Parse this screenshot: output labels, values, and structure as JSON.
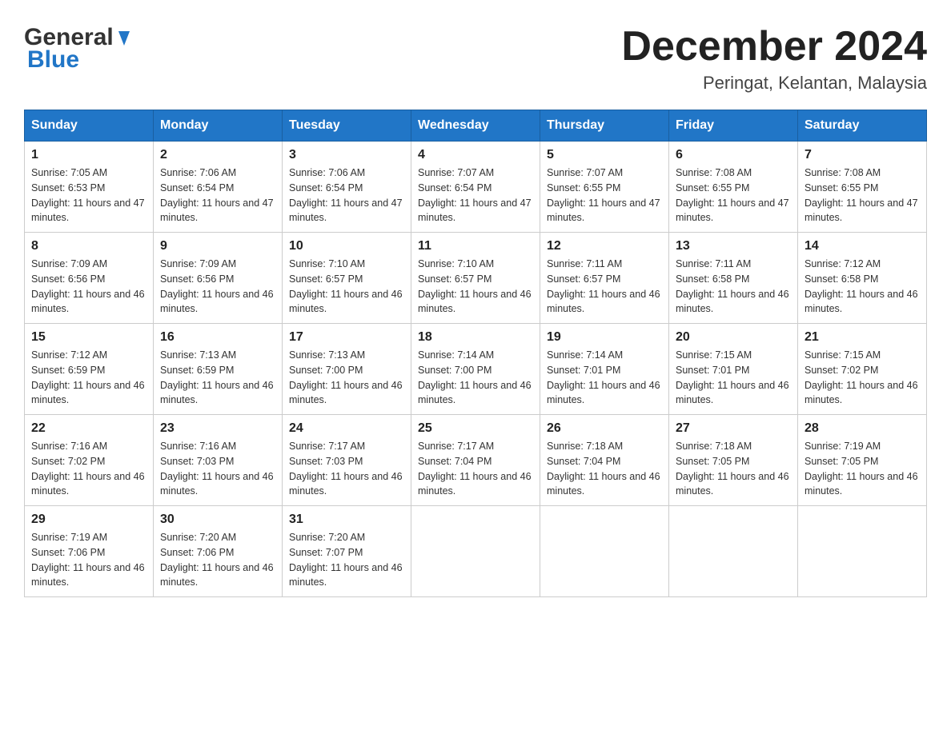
{
  "header": {
    "title": "December 2024",
    "subtitle": "Peringat, Kelantan, Malaysia",
    "logo_general": "General",
    "logo_blue": "Blue"
  },
  "columns": [
    "Sunday",
    "Monday",
    "Tuesday",
    "Wednesday",
    "Thursday",
    "Friday",
    "Saturday"
  ],
  "weeks": [
    [
      {
        "day": "1",
        "sunrise": "7:05 AM",
        "sunset": "6:53 PM",
        "daylight": "11 hours and 47 minutes."
      },
      {
        "day": "2",
        "sunrise": "7:06 AM",
        "sunset": "6:54 PM",
        "daylight": "11 hours and 47 minutes."
      },
      {
        "day": "3",
        "sunrise": "7:06 AM",
        "sunset": "6:54 PM",
        "daylight": "11 hours and 47 minutes."
      },
      {
        "day": "4",
        "sunrise": "7:07 AM",
        "sunset": "6:54 PM",
        "daylight": "11 hours and 47 minutes."
      },
      {
        "day": "5",
        "sunrise": "7:07 AM",
        "sunset": "6:55 PM",
        "daylight": "11 hours and 47 minutes."
      },
      {
        "day": "6",
        "sunrise": "7:08 AM",
        "sunset": "6:55 PM",
        "daylight": "11 hours and 47 minutes."
      },
      {
        "day": "7",
        "sunrise": "7:08 AM",
        "sunset": "6:55 PM",
        "daylight": "11 hours and 47 minutes."
      }
    ],
    [
      {
        "day": "8",
        "sunrise": "7:09 AM",
        "sunset": "6:56 PM",
        "daylight": "11 hours and 46 minutes."
      },
      {
        "day": "9",
        "sunrise": "7:09 AM",
        "sunset": "6:56 PM",
        "daylight": "11 hours and 46 minutes."
      },
      {
        "day": "10",
        "sunrise": "7:10 AM",
        "sunset": "6:57 PM",
        "daylight": "11 hours and 46 minutes."
      },
      {
        "day": "11",
        "sunrise": "7:10 AM",
        "sunset": "6:57 PM",
        "daylight": "11 hours and 46 minutes."
      },
      {
        "day": "12",
        "sunrise": "7:11 AM",
        "sunset": "6:57 PM",
        "daylight": "11 hours and 46 minutes."
      },
      {
        "day": "13",
        "sunrise": "7:11 AM",
        "sunset": "6:58 PM",
        "daylight": "11 hours and 46 minutes."
      },
      {
        "day": "14",
        "sunrise": "7:12 AM",
        "sunset": "6:58 PM",
        "daylight": "11 hours and 46 minutes."
      }
    ],
    [
      {
        "day": "15",
        "sunrise": "7:12 AM",
        "sunset": "6:59 PM",
        "daylight": "11 hours and 46 minutes."
      },
      {
        "day": "16",
        "sunrise": "7:13 AM",
        "sunset": "6:59 PM",
        "daylight": "11 hours and 46 minutes."
      },
      {
        "day": "17",
        "sunrise": "7:13 AM",
        "sunset": "7:00 PM",
        "daylight": "11 hours and 46 minutes."
      },
      {
        "day": "18",
        "sunrise": "7:14 AM",
        "sunset": "7:00 PM",
        "daylight": "11 hours and 46 minutes."
      },
      {
        "day": "19",
        "sunrise": "7:14 AM",
        "sunset": "7:01 PM",
        "daylight": "11 hours and 46 minutes."
      },
      {
        "day": "20",
        "sunrise": "7:15 AM",
        "sunset": "7:01 PM",
        "daylight": "11 hours and 46 minutes."
      },
      {
        "day": "21",
        "sunrise": "7:15 AM",
        "sunset": "7:02 PM",
        "daylight": "11 hours and 46 minutes."
      }
    ],
    [
      {
        "day": "22",
        "sunrise": "7:16 AM",
        "sunset": "7:02 PM",
        "daylight": "11 hours and 46 minutes."
      },
      {
        "day": "23",
        "sunrise": "7:16 AM",
        "sunset": "7:03 PM",
        "daylight": "11 hours and 46 minutes."
      },
      {
        "day": "24",
        "sunrise": "7:17 AM",
        "sunset": "7:03 PM",
        "daylight": "11 hours and 46 minutes."
      },
      {
        "day": "25",
        "sunrise": "7:17 AM",
        "sunset": "7:04 PM",
        "daylight": "11 hours and 46 minutes."
      },
      {
        "day": "26",
        "sunrise": "7:18 AM",
        "sunset": "7:04 PM",
        "daylight": "11 hours and 46 minutes."
      },
      {
        "day": "27",
        "sunrise": "7:18 AM",
        "sunset": "7:05 PM",
        "daylight": "11 hours and 46 minutes."
      },
      {
        "day": "28",
        "sunrise": "7:19 AM",
        "sunset": "7:05 PM",
        "daylight": "11 hours and 46 minutes."
      }
    ],
    [
      {
        "day": "29",
        "sunrise": "7:19 AM",
        "sunset": "7:06 PM",
        "daylight": "11 hours and 46 minutes."
      },
      {
        "day": "30",
        "sunrise": "7:20 AM",
        "sunset": "7:06 PM",
        "daylight": "11 hours and 46 minutes."
      },
      {
        "day": "31",
        "sunrise": "7:20 AM",
        "sunset": "7:07 PM",
        "daylight": "11 hours and 46 minutes."
      },
      null,
      null,
      null,
      null
    ]
  ]
}
